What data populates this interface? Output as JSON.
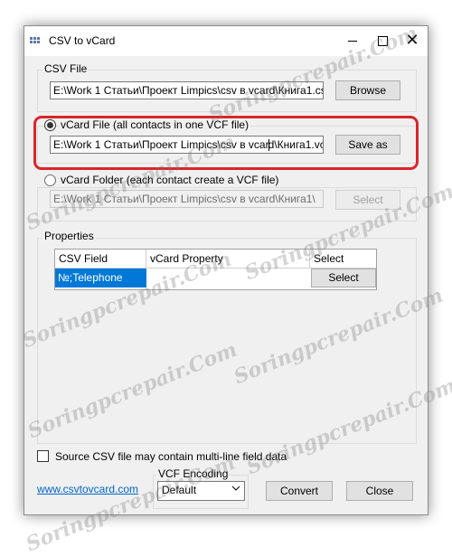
{
  "window": {
    "title": "CSV to vCard",
    "close_glyph": "✕"
  },
  "csv_file": {
    "group_label": "CSV File",
    "path": "E:\\Work 1 Статьи\\Проект Limpics\\csv в vcard\\Книга1.csv",
    "browse_label": "Browse"
  },
  "vcard_file": {
    "radio_label": "vCard File (all contacts in one VCF file)",
    "path_before_caret": "E:\\Work 1 Статьи\\Проект Limpics\\csv в vcar",
    "path_after_caret": "d\\Книга1.vcf",
    "save_as_label": "Save as",
    "selected": true
  },
  "vcard_folder": {
    "radio_label": "vCard Folder (each contact create a VCF file)",
    "path": "E:\\Work 1 Статьи\\Проект Limpics\\csv в vcard\\Книга1\\",
    "select_label": "Select",
    "selected": false
  },
  "properties": {
    "group_label": "Properties",
    "columns": [
      "CSV Field",
      "vCard Property",
      "Select"
    ],
    "rows": [
      {
        "csv_field": "№;Telephone",
        "vcard_property": "",
        "button_label": "Select"
      }
    ]
  },
  "multiline": {
    "label": "Source CSV file may contain multi-line field data",
    "checked": false
  },
  "footer": {
    "website_link": "www.csvtovcard.com",
    "encoding_label": "VCF Encoding",
    "encoding_value": "Default",
    "convert_label": "Convert",
    "close_label": "Close"
  },
  "watermark": "Soringpcrepair.Com",
  "colors": {
    "highlight": "#d9262b",
    "selection": "#0078d7",
    "link": "#0066cc"
  }
}
